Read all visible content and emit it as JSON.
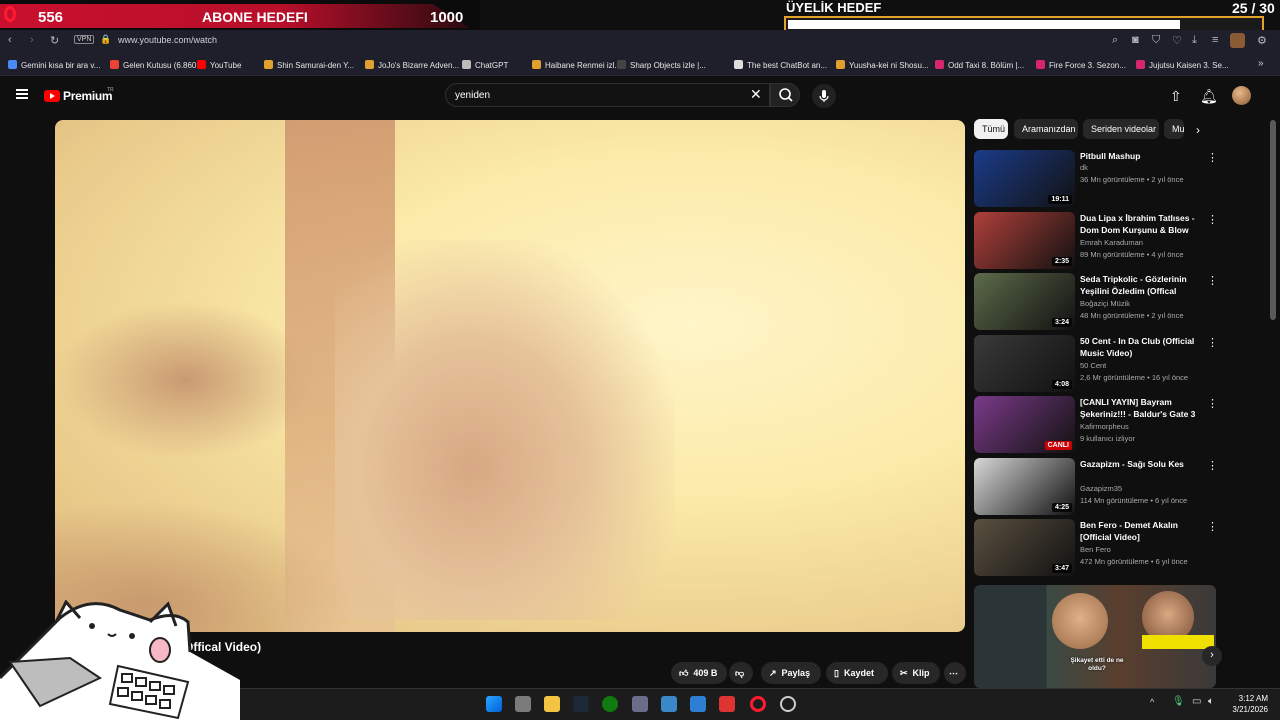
{
  "overlay": {
    "left_count": "556",
    "left_goal_label": "ABONE HEDEFI",
    "left_goal_target": "1000",
    "right_title": "ÜYELİK HEDEF",
    "right_count": "25 / 30",
    "member_progress": 0.83,
    "accent_colors": {
      "red": "#c8102e",
      "gold": "#e3a32a"
    }
  },
  "browser": {
    "vpn_label": "VPN",
    "url": "www.youtube.com/watch",
    "bookmarks": [
      {
        "label": "Gemini kısa bir ara v...",
        "color": "#4a8af4"
      },
      {
        "label": "Gelen Kutusu (6.860...",
        "color": "#ea4335"
      },
      {
        "label": "YouTube",
        "color": "#ff0000"
      },
      {
        "label": "Shin Samurai-den Y...",
        "color": "#e0a030"
      },
      {
        "label": "JoJo's Bizarre Adven...",
        "color": "#e0a030"
      },
      {
        "label": "ChatGPT",
        "color": "#bbbbbb"
      },
      {
        "label": "Haibane Renmei izl...",
        "color": "#e0a030"
      },
      {
        "label": "Sharp Objects izle |...",
        "color": "#444444"
      },
      {
        "label": "The best ChatBot an...",
        "color": "#dddddd"
      },
      {
        "label": "Yuusha-kei ni Shosu...",
        "color": "#e0a030"
      },
      {
        "label": "Odd Taxi 8. Bölüm |...",
        "color": "#d6246e"
      },
      {
        "label": "Fire Force 3. Sezon...",
        "color": "#d6246e"
      },
      {
        "label": "Jujutsu Kaisen 3. Se...",
        "color": "#d6246e"
      }
    ]
  },
  "youtube": {
    "logo_text": "Premium",
    "logo_badge": "TR",
    "search_value": "yeniden",
    "video_title_visible": "Offical Video)",
    "actions": {
      "likes": "409 B",
      "share": "Paylaş",
      "save": "Kaydet",
      "clip": "Klip"
    },
    "chips": [
      "Tümü",
      "Aramanızdan",
      "Seriden videolar",
      "Mu"
    ],
    "recommendations": [
      {
        "title": "Pitbull Mashup",
        "channel": "dk",
        "meta": "36 Mn görüntüleme • 2 yıl önce",
        "duration": "19:11",
        "thumb": "#1b3c8a"
      },
      {
        "title": "Dua Lipa x İbrahim Tatlıses - Dom Dom Kurşunu & Blow You...",
        "channel": "Emrah Karaduman",
        "meta": "89 Mn görüntüleme • 4 yıl önce",
        "duration": "2:35",
        "thumb": "#b0403a"
      },
      {
        "title": "Seda Tripkolic - Gözlerinin Yeşilini Özledim (Offical Video)",
        "channel": "Boğaziçi Müzik",
        "meta": "48 Mn görüntüleme • 2 yıl önce",
        "duration": "3:24",
        "thumb": "#5d6b4a"
      },
      {
        "title": "50 Cent - In Da Club (Official Music Video)",
        "channel": "50 Cent",
        "meta": "2,6 Mr görüntüleme • 16 yıl önce",
        "duration": "4:08",
        "thumb": "#3a3a3a"
      },
      {
        "title": "[CANLI YAYIN] Bayram Şekeriniz!!! - Baldur's Gate 3",
        "channel": "Kafirmorpheus",
        "meta": "9 kullanıcı izliyor",
        "duration": "CANLI",
        "thumb": "#7a3a8a"
      },
      {
        "title": "Gazapizm - Sağı Solu Kes",
        "channel": "Gazapizm35",
        "meta": "114 Mn görüntüleme • 6 yıl önce",
        "duration": "4:25",
        "thumb": "#d8d8d8"
      },
      {
        "title": "Ben Fero - Demet Akalın [Official Video]",
        "channel": "Ben Fero",
        "meta": "472 Mn görüntüleme • 6 yıl önce",
        "duration": "3:47",
        "thumb": "#5a5040"
      }
    ],
    "shorts_caption": "Şikayet etti de ne oldu?"
  },
  "taskbar": {
    "time": "3:12 AM",
    "date": "3/21/2026"
  }
}
